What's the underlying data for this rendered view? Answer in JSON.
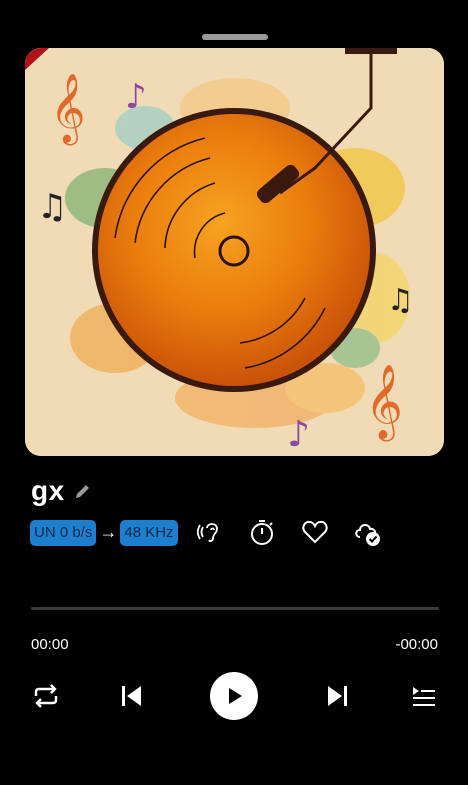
{
  "track": {
    "title": "gx"
  },
  "stream": {
    "bitrate": "UN 0 b/s",
    "arrow": "→",
    "sample_rate": "48 KHz"
  },
  "playback": {
    "elapsed": "00:00",
    "remaining": "-00:00",
    "progress": 0
  },
  "icons": {
    "edit": "pencil-icon",
    "hearing": "ear-icon",
    "timer": "stopwatch-icon",
    "favorite": "heart-icon",
    "cloud": "cloud-check-icon",
    "repeat": "repeat-icon",
    "previous": "skip-previous-icon",
    "play": "play-icon",
    "next": "skip-next-icon",
    "queue": "playlist-icon"
  },
  "colors": {
    "background": "#000000",
    "accent_badge": "#1f7fcf",
    "record": "#e8800f"
  }
}
